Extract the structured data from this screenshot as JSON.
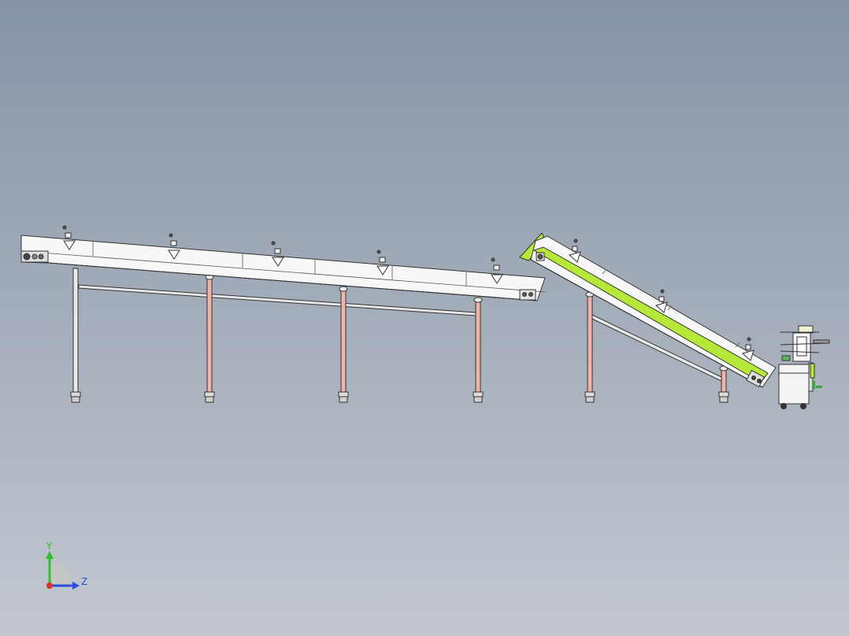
{
  "colors": {
    "background_top": "#8794a6",
    "background_bottom": "#c3c8d0",
    "frame": "#f7f7f7",
    "outline": "#333333",
    "accent_green": "#b6e83a",
    "leg_tube": "#f0b3a8",
    "axis_x": "#e0302a",
    "axis_y": "#2ec12e",
    "axis_z": "#2a4ee0"
  },
  "triad": {
    "y_label": "Y",
    "z_label": "Z"
  }
}
